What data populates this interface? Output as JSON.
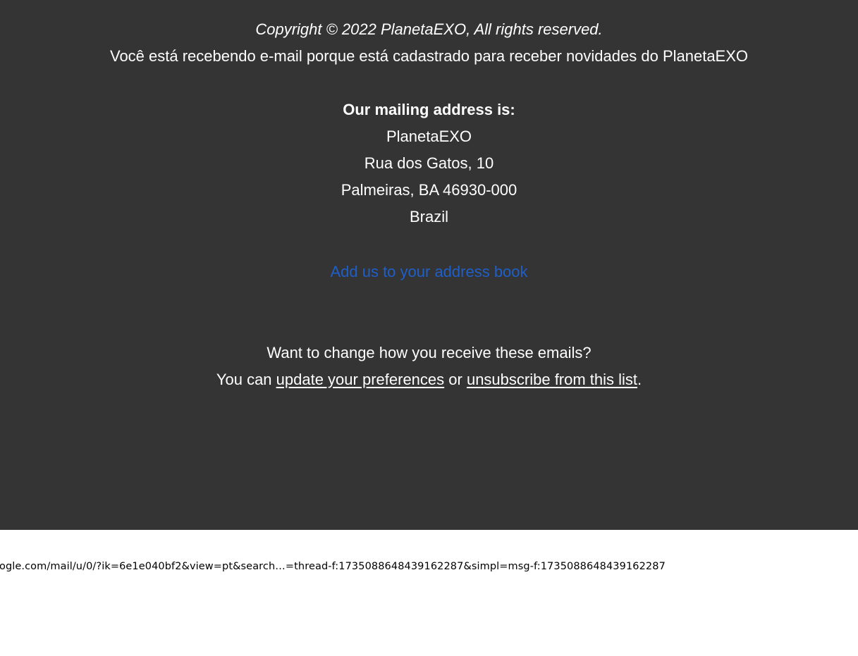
{
  "footer": {
    "copyright": "Copyright © 2022 PlanetaEXO, All rights reserved.",
    "notice": "Você está recebendo e-mail porque está cadastrado para receber novidades do PlanetaEXO",
    "mailing_heading": "Our mailing address is:",
    "address": {
      "name": "PlanetaEXO",
      "street": "Rua dos Gatos, 10",
      "city": "Palmeiras, BA 46930-000",
      "country": "Brazil"
    },
    "address_book_link": "Add us to your address book",
    "change_question": "Want to change how you receive these emails?",
    "you_can": "You can ",
    "update_preferences_link": "update your preferences",
    "or": " or ",
    "unsubscribe_link": "unsubscribe from this list",
    "period": "."
  },
  "status_bar": {
    "url": "oogle.com/mail/u/0/?ik=6e1e040bf2&view=pt&search…=thread-f:1735088648439162287&simpl=msg-f:1735088648439162287"
  },
  "colors": {
    "footer_background": "#343434",
    "link_blue": "#1f5fc8",
    "text": "#ffffff"
  }
}
